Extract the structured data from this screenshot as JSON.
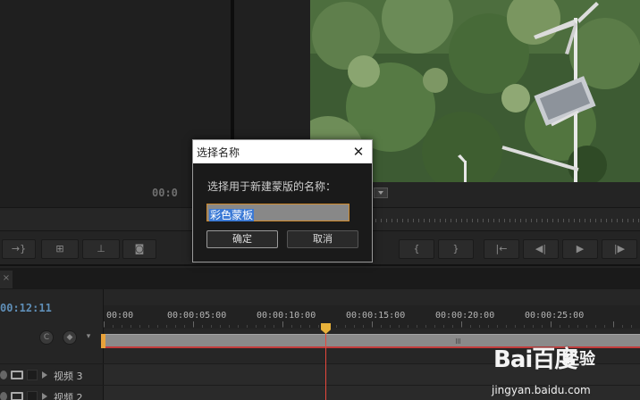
{
  "monitors": {
    "source_timecode": "00:0"
  },
  "transport": {
    "left_buttons": [
      "→}",
      "⊞",
      "⊥",
      "◙"
    ],
    "right_buttons": [
      "{",
      "}",
      "|←",
      "◀|",
      "▶",
      "|▶"
    ]
  },
  "timeline": {
    "close_tab": "×",
    "timecode": "00:12:11",
    "ruler_labels": [
      "00:00",
      "00:00:05:00",
      "00:00:10:00",
      "00:00:15:00",
      "00:00:20:00",
      "00:00:25:00"
    ],
    "tracks": [
      {
        "name": "视频 3"
      },
      {
        "name": "视频 2"
      }
    ]
  },
  "dialog": {
    "title": "选择名称",
    "close_glyph": "✕",
    "prompt": "选择用于新建蒙版的名称：",
    "input_value": "彩色蒙板",
    "ok_label": "确定",
    "cancel_label": "取消"
  },
  "watermark": {
    "logo": "Bai百度",
    "jingyan": "经验",
    "url": "jingyan.baidu.com"
  },
  "colors": {
    "playhead": "#e7473c",
    "accent_orange": "#d08a2c",
    "selection_blue": "#3b7ad6"
  }
}
